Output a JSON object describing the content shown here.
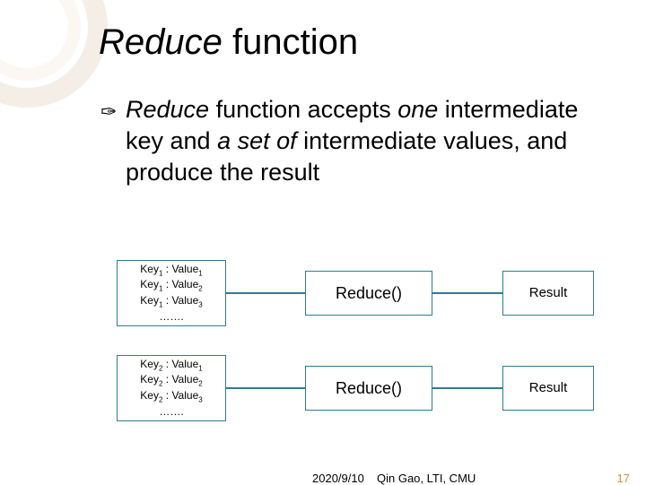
{
  "title": {
    "italic": "Reduce ",
    "rest": "function"
  },
  "body": {
    "seg1_italic": "Reduce",
    "seg2": " function accepts ",
    "seg3_italic": "one",
    "seg4": " intermediate key and ",
    "seg5_italic": "a set of",
    "seg6": " intermediate values, and produce the result"
  },
  "diagram": {
    "rows": [
      {
        "keys": [
          "Key1 : Value1",
          "Key1 : Value2",
          "Key1 : Value3",
          "……."
        ],
        "mid": "Reduce()",
        "out": "Result"
      },
      {
        "keys": [
          "Key2 : Value1",
          "Key2 : Value2",
          "Key2 : Value3",
          "……."
        ],
        "mid": "Reduce()",
        "out": "Result"
      }
    ]
  },
  "footer": {
    "date": "2020/9/10",
    "author": "Qin Gao, LTI, CMU",
    "page": "17"
  },
  "bullet_glyph": "✑"
}
